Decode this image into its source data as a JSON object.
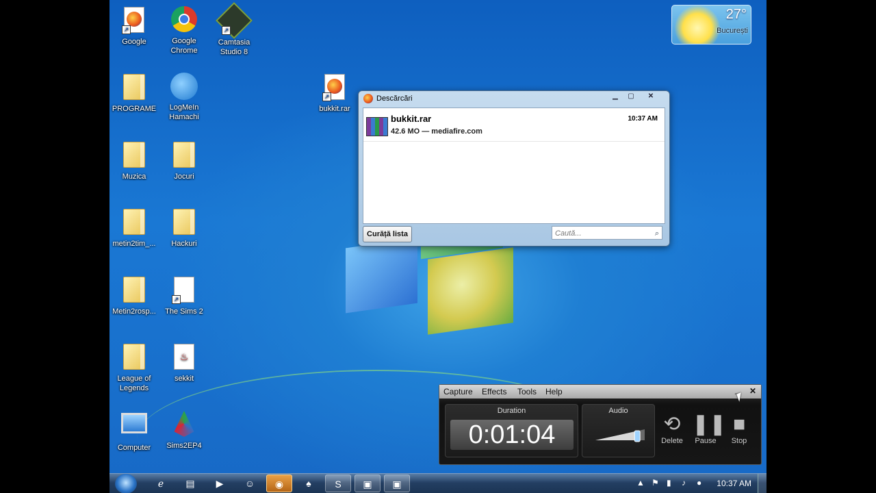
{
  "desktop_icons": [
    {
      "label": "Google",
      "icon": "firefox-icon"
    },
    {
      "label": "Google Chrome",
      "icon": "chrome-icon"
    },
    {
      "label": "Camtasia Studio 8",
      "icon": "camtasia-icon"
    },
    {
      "label": "PROGRAME",
      "icon": "folder-icon"
    },
    {
      "label": "LogMeIn Hamachi",
      "icon": "hamachi-icon"
    },
    {
      "label": "bukkit.rar",
      "icon": "firefox-icon"
    },
    {
      "label": "Muzica",
      "icon": "folder-icon"
    },
    {
      "label": "Jocuri",
      "icon": "folder-icon"
    },
    {
      "label": "metin2tim_...",
      "icon": "folder-icon"
    },
    {
      "label": "Hackuri",
      "icon": "folder-icon"
    },
    {
      "label": "Metin2rosp...",
      "icon": "folder-icon"
    },
    {
      "label": "The Sims 2",
      "icon": "document-icon"
    },
    {
      "label": "League of Legends",
      "icon": "folder-icon"
    },
    {
      "label": "sekkit",
      "icon": "java-icon"
    },
    {
      "label": "Computer",
      "icon": "computer-icon"
    },
    {
      "label": "Sims2EP4",
      "icon": "sims-icon"
    }
  ],
  "weather": {
    "temperature": "27°",
    "city": "București"
  },
  "downloads_window": {
    "title": "Descărcări",
    "item": {
      "filename": "bukkit.rar",
      "status": "42.6 MO — mediafire.com",
      "time": "10:37 AM"
    },
    "clear_button": "Curăță lista",
    "search_placeholder": "Caută..."
  },
  "recorder": {
    "menu": [
      "Capture",
      "Effects",
      "Tools",
      "Help"
    ],
    "duration_label": "Duration",
    "duration": "0:01:04",
    "audio_label": "Audio",
    "audio_level": 0.85,
    "controls": {
      "delete": "Delete",
      "pause": "Pause",
      "stop": "Stop"
    }
  },
  "taskbar": {
    "pinned": [
      "internet-explorer-icon",
      "explorer-folder-icon",
      "media-player-icon",
      "emoticon-icon",
      "firefox-icon",
      "game-icon",
      "skype-icon",
      "camtasia-icon",
      "camtasia-recorder-icon"
    ],
    "clock": "10:37 AM"
  }
}
